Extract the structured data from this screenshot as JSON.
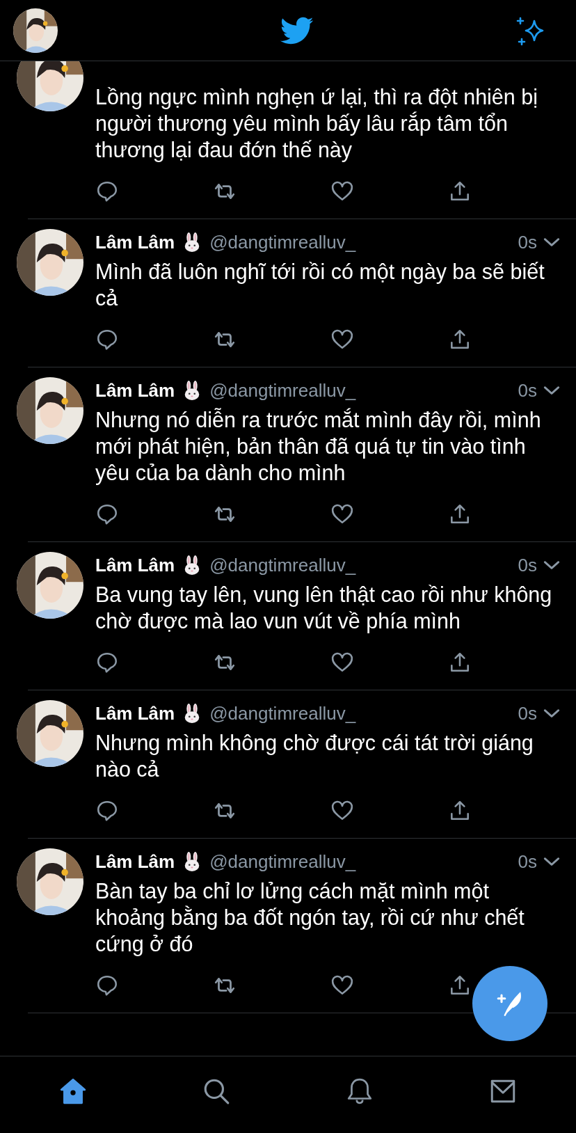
{
  "tweets": [
    {
      "text": "Lồng ngực mình nghẹn ứ lại, thì ra đột nhiên bị người thương yêu mình bấy lâu rắp tâm tổn thương lại đau đớn thế này"
    },
    {
      "name": "Lâm Lâm",
      "handle": "@dangtimrealluv_",
      "time": "0s",
      "text": "Mình đã luôn nghĩ tới rồi có một ngày ba sẽ biết cả"
    },
    {
      "name": "Lâm Lâm",
      "handle": "@dangtimrealluv_",
      "time": "0s",
      "text": "Nhưng nó diễn ra trước mắt mình đây rồi, mình mới phát hiện, bản thân đã quá tự tin vào tình yêu của ba dành cho mình"
    },
    {
      "name": "Lâm Lâm",
      "handle": "@dangtimrealluv_",
      "time": "0s",
      "text": "Ba vung tay lên, vung lên thật cao rồi như không chờ được mà lao vun vút về phía mình"
    },
    {
      "name": "Lâm Lâm",
      "handle": "@dangtimrealluv_",
      "time": "0s",
      "text": "Nhưng mình không chờ được cái tát trời giáng nào cả"
    },
    {
      "name": "Lâm Lâm",
      "handle": "@dangtimrealluv_",
      "time": "0s",
      "text": "Bàn tay ba chỉ lơ lửng cách mặt mình một khoảng bằng ba đốt ngón tay, rồi cứ như chết cứng ở đó"
    }
  ],
  "bottom_nav": [
    {
      "selected": true
    },
    {
      "selected": false
    },
    {
      "selected": false
    },
    {
      "selected": false
    }
  ]
}
